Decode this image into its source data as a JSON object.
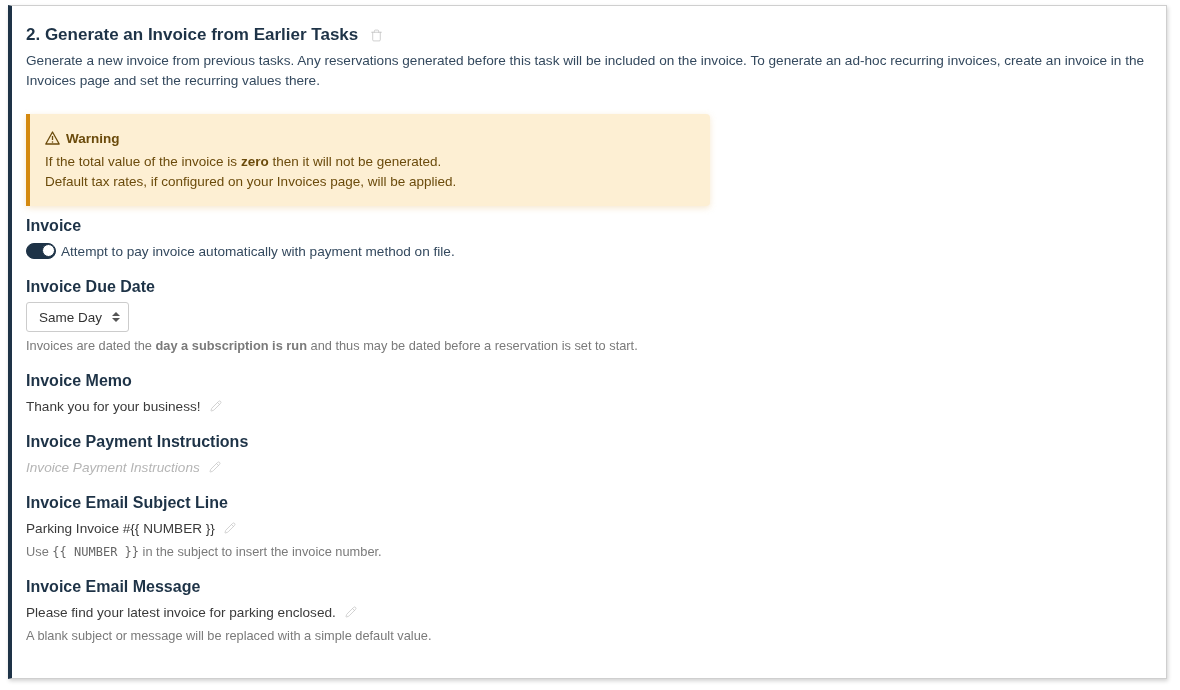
{
  "section": {
    "title": "2. Generate an Invoice from Earlier Tasks",
    "description": "Generate a new invoice from previous tasks. Any reservations generated before this task will be included on the invoice. To generate an ad-hoc recurring invoices, create an invoice in the Invoices page and set the recurring values there."
  },
  "warning": {
    "title": "Warning",
    "lines": [
      "If the total value of the invoice is **zero** then it will not be generated.",
      "Default tax rates, if configured on your Invoices page, will be applied."
    ]
  },
  "fields": [
    {
      "kind": "toggle",
      "label": "Invoice",
      "on": true,
      "text": "Attempt to pay invoice automatically with payment method on file."
    },
    {
      "kind": "select",
      "label": "Invoice Due Date",
      "value": "Same Day",
      "help": [
        {
          "kind": "text",
          "text": "Invoices are dated the **day a subscription is run** and thus may be dated before a reservation is set to start."
        }
      ]
    },
    {
      "kind": "editable",
      "label": "Invoice Memo",
      "value": "Thank you for your business!"
    },
    {
      "kind": "editable",
      "label": "Invoice Payment Instructions",
      "placeholder": "Invoice Payment Instructions"
    },
    {
      "kind": "editable",
      "label": "Invoice Email Subject Line",
      "value": "Parking Invoice #{{ NUMBER }}",
      "help": [
        {
          "kind": "text",
          "text": "Use"
        },
        {
          "kind": "code",
          "text": "{{ NUMBER }}"
        },
        {
          "kind": "text",
          "text": "in the subject to insert the invoice number."
        }
      ]
    },
    {
      "kind": "editable",
      "label": "Invoice Email Message",
      "value": "Please find your latest invoice for parking enclosed.",
      "help": [
        {
          "kind": "text",
          "text": "A blank subject or message will be replaced with a simple default value."
        }
      ]
    }
  ]
}
